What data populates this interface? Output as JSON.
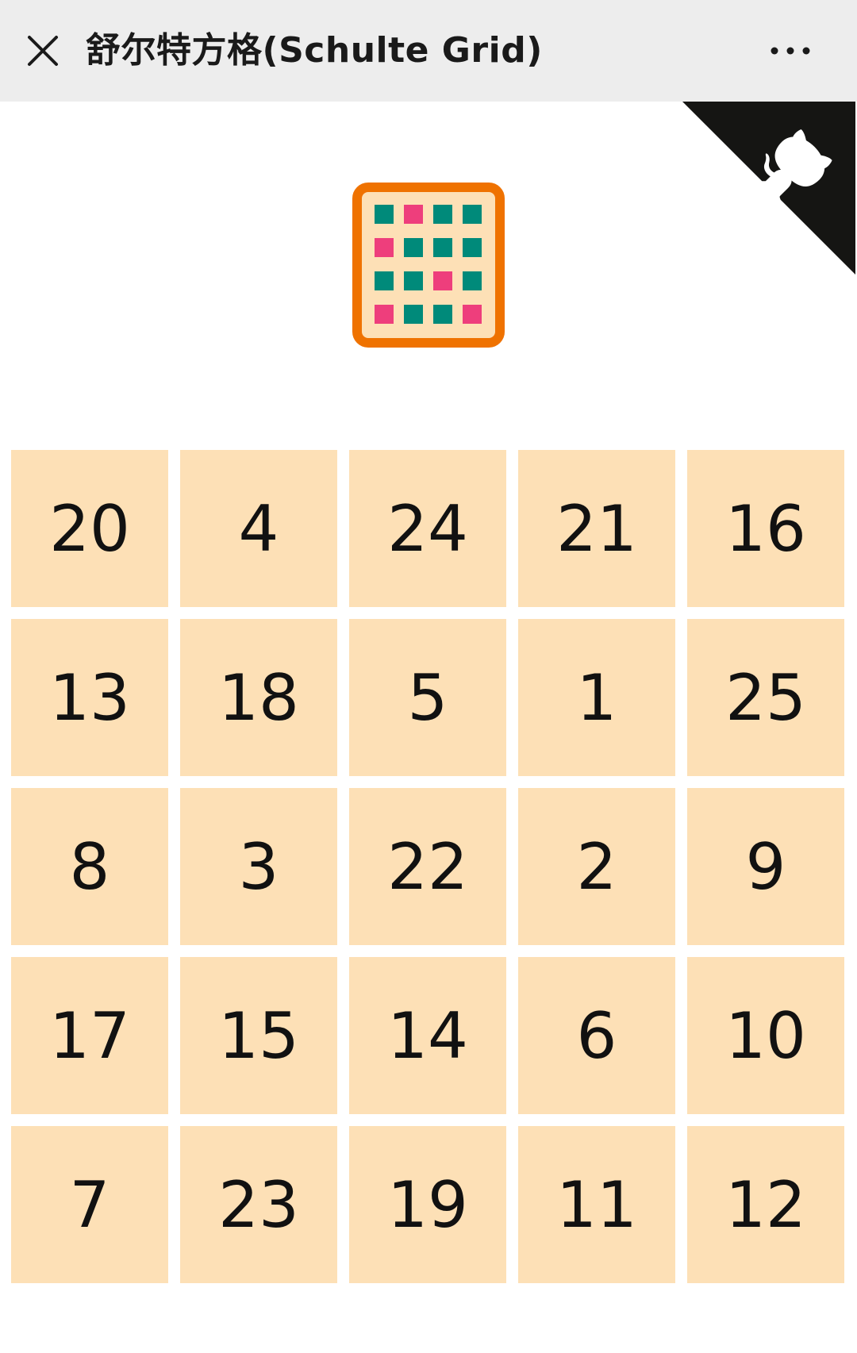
{
  "header": {
    "title": "舒尔特方格(Schulte Grid)",
    "close_icon": "close-icon",
    "more_icon": "more-dots-icon"
  },
  "corner": {
    "icon": "github-octocat-icon",
    "background": "#151513"
  },
  "logo": {
    "icon": "schulte-grid-logo-icon",
    "frame_color": "#ef7200",
    "fill_color": "#fde0b6",
    "teal": "#008a7a",
    "pink": "#ee3e7c"
  },
  "grid": {
    "cell_color": "#fde0b6",
    "cells": [
      "20",
      "4",
      "24",
      "21",
      "16",
      "13",
      "18",
      "5",
      "1",
      "25",
      "8",
      "3",
      "22",
      "2",
      "9",
      "17",
      "15",
      "14",
      "6",
      "10",
      "7",
      "23",
      "19",
      "11",
      "12"
    ]
  }
}
